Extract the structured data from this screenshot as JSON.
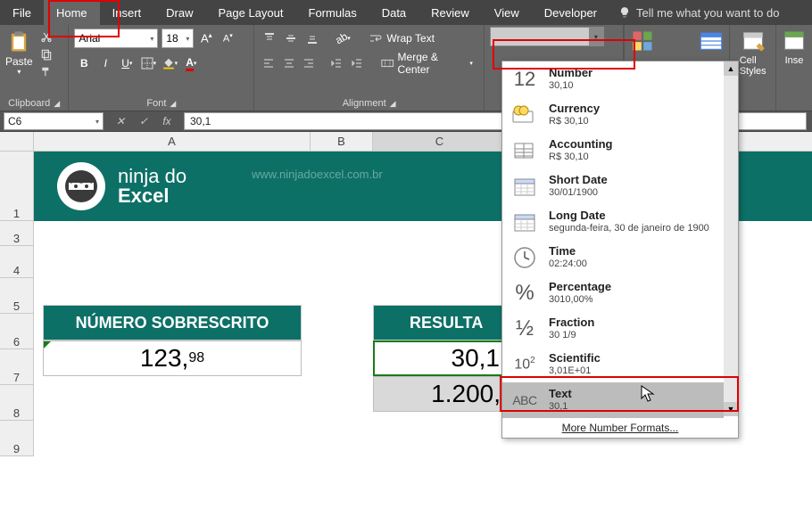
{
  "tabs": [
    "File",
    "Home",
    "Insert",
    "Draw",
    "Page Layout",
    "Formulas",
    "Data",
    "Review",
    "View",
    "Developer"
  ],
  "active_tab": "Home",
  "tell_me": "Tell me what you want to do",
  "ribbon": {
    "clipboard": {
      "paste": "Paste",
      "label": "Clipboard"
    },
    "font": {
      "name": "Arial",
      "size": "18",
      "buttons": {
        "bold": "B",
        "italic": "I",
        "underline": "U"
      },
      "label": "Font"
    },
    "alignment": {
      "wrap": "Wrap Text",
      "merge": "Merge & Center",
      "label": "Alignment"
    },
    "styles": {
      "cell_styles": "Cell\nStyles",
      "insert": "Inse"
    }
  },
  "namebox": "C6",
  "formula": "30,1",
  "columns": [
    "A",
    "B",
    "C"
  ],
  "rows": [
    "1",
    "3",
    "4",
    "5",
    "6",
    "7",
    "8",
    "9"
  ],
  "banner": {
    "line1": "ninja do",
    "line2": "Excel",
    "url": "www.ninjadoexcel.com.br"
  },
  "sheet": {
    "header_left": "NÚMERO SOBRESCRITO",
    "header_right": "RESULTA",
    "a6_main": "123,",
    "a6_sup": "98",
    "c6": "30,1",
    "c7": "1.200,"
  },
  "dropdown": {
    "items": [
      {
        "icon": "12",
        "title": "Number",
        "sample": "30,10"
      },
      {
        "icon": "cur",
        "title": "Currency",
        "sample": "R$ 30,10"
      },
      {
        "icon": "acc",
        "title": "Accounting",
        "sample": "R$ 30,10"
      },
      {
        "icon": "cal",
        "title": "Short Date",
        "sample": "30/01/1900"
      },
      {
        "icon": "cal",
        "title": "Long Date",
        "sample": "segunda-feira, 30 de janeiro de 1900"
      },
      {
        "icon": "clk",
        "title": "Time",
        "sample": "02:24:00"
      },
      {
        "icon": "%",
        "title": "Percentage",
        "sample": "3010,00%"
      },
      {
        "icon": "½",
        "title": "Fraction",
        "sample": "30 1/9"
      },
      {
        "icon": "10²",
        "title": "Scientific",
        "sample": "3,01E+01"
      },
      {
        "icon": "ABC",
        "title": "Text",
        "sample": "30,1",
        "hover": true
      }
    ],
    "more": "More Number Formats..."
  }
}
